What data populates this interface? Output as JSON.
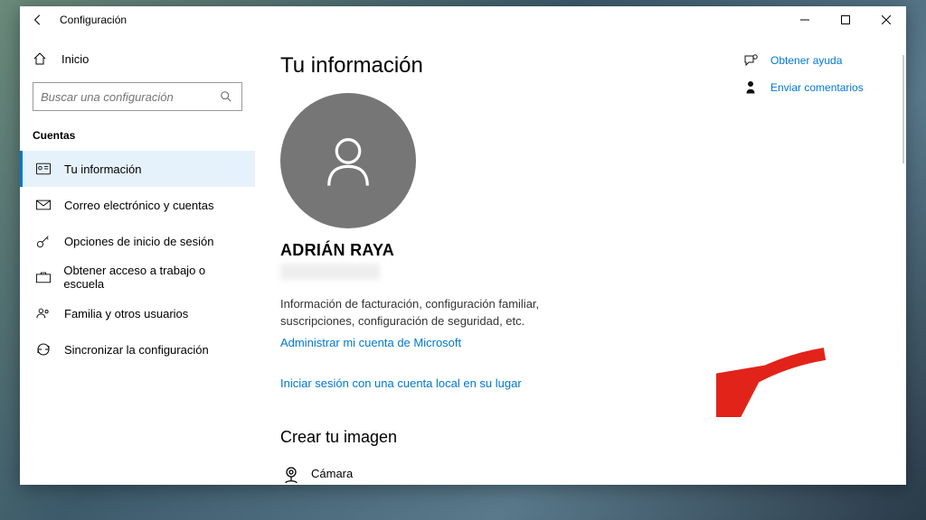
{
  "window": {
    "title": "Configuración"
  },
  "sidebar": {
    "home": "Inicio",
    "search_placeholder": "Buscar una configuración",
    "section": "Cuentas",
    "items": [
      {
        "label": "Tu información"
      },
      {
        "label": "Correo electrónico y cuentas"
      },
      {
        "label": "Opciones de inicio de sesión"
      },
      {
        "label": "Obtener acceso a trabajo o escuela"
      },
      {
        "label": "Familia y otros usuarios"
      },
      {
        "label": "Sincronizar la configuración"
      }
    ]
  },
  "main": {
    "heading": "Tu información",
    "username": "ADRIÁN RAYA",
    "billing_desc": "Información de facturación, configuración familiar, suscripciones, configuración de seguridad, etc.",
    "manage_link": "Administrar mi cuenta de Microsoft",
    "local_signin_link": "Iniciar sesión con una cuenta local en su lugar",
    "create_image_heading": "Crear tu imagen",
    "camera_label": "Cámara"
  },
  "right": {
    "help": "Obtener ayuda",
    "feedback": "Enviar comentarios"
  }
}
